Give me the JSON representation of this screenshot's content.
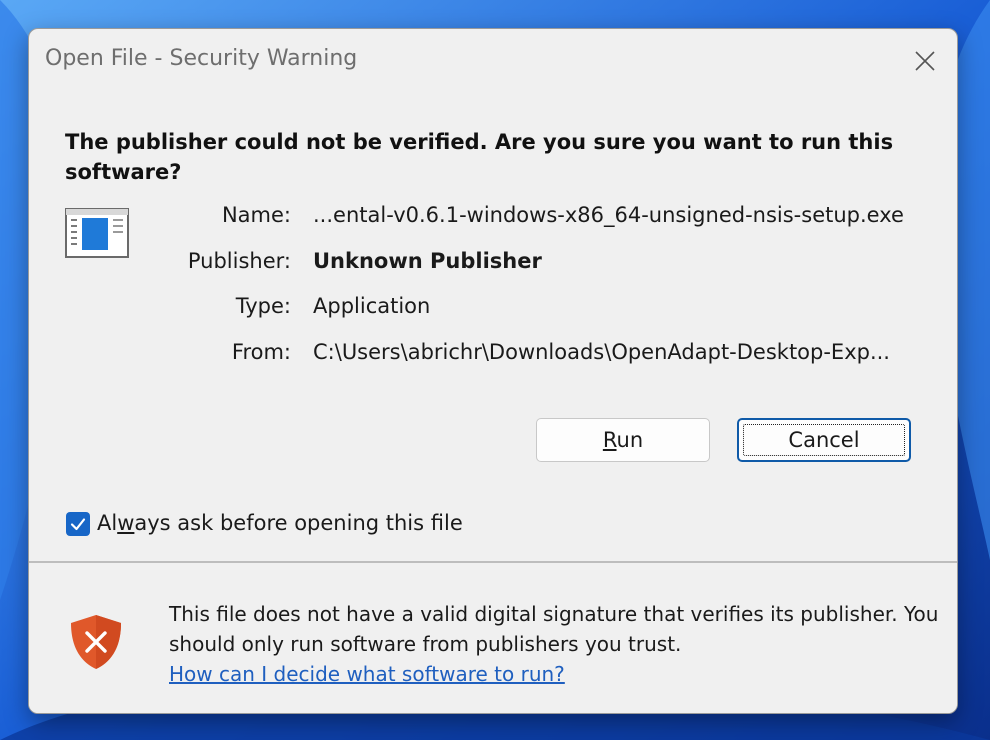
{
  "window": {
    "title": "Open File - Security Warning",
    "close_icon": "close-icon"
  },
  "headline": "The publisher could not be verified.  Are you sure you want to run this software?",
  "details": {
    "name_label": "Name:",
    "name_value": "...ental-v0.6.1-windows-x86_64-unsigned-nsis-setup.exe",
    "publisher_label": "Publisher:",
    "publisher_value": "Unknown Publisher",
    "type_label": "Type:",
    "type_value": "Application",
    "from_label": "From:",
    "from_value": "C:\\Users\\abrichr\\Downloads\\OpenAdapt-Desktop-Exp..."
  },
  "buttons": {
    "run_label_pre": "",
    "run_label_key": "R",
    "run_label_post": "un",
    "cancel_label": "Cancel"
  },
  "checkbox": {
    "checked": true,
    "label_pre": "Al",
    "label_key": "w",
    "label_post": "ays ask before opening this file"
  },
  "footer": {
    "message": "This file does not have a valid digital signature that verifies its publisher.  You should only run software from publishers you trust.",
    "link": "How can I decide what software to run?"
  },
  "icons": {
    "app": "application-window-icon",
    "shield": "shield-error-icon",
    "check": "check-icon"
  },
  "colors": {
    "accent": "#1766c7",
    "link": "#1f5fbf",
    "shield": "#e0582a"
  }
}
